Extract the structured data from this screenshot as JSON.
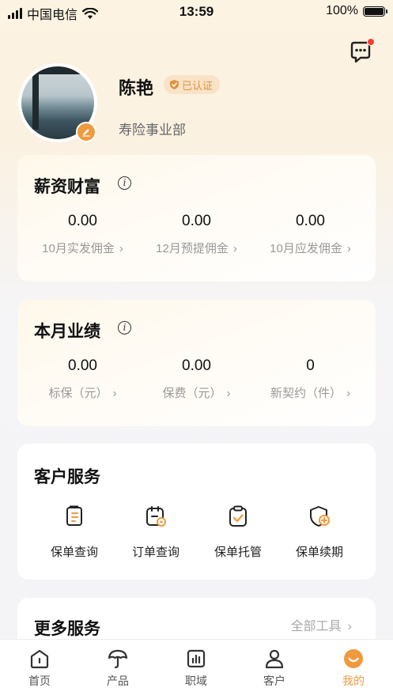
{
  "status_bar": {
    "carrier": "中国电信",
    "time": "13:59",
    "battery": "100%"
  },
  "profile": {
    "name": "陈艳",
    "verified": "已认证",
    "department": "寿险事业部"
  },
  "salary": {
    "title": "薪资财富",
    "items": [
      {
        "value": "0.00",
        "label": "10月实发佣金"
      },
      {
        "value": "0.00",
        "label": "12月预提佣金"
      },
      {
        "value": "0.00",
        "label": "10月应发佣金"
      }
    ]
  },
  "performance": {
    "title": "本月业绩",
    "items": [
      {
        "value": "0.00",
        "label": "标保（元）"
      },
      {
        "value": "0.00",
        "label": "保费（元）"
      },
      {
        "value": "0",
        "label": "新契约（件）"
      }
    ]
  },
  "customer_service": {
    "title": "客户服务",
    "items": [
      {
        "label": "保单查询",
        "icon": "policy-query-icon"
      },
      {
        "label": "订单查询",
        "icon": "order-query-icon"
      },
      {
        "label": "保单托管",
        "icon": "policy-custody-icon"
      },
      {
        "label": "保单续期",
        "icon": "policy-renewal-icon"
      }
    ]
  },
  "more_services": {
    "title": "更多服务",
    "link": "全部工具"
  },
  "tabbar": {
    "items": [
      {
        "label": "首页",
        "icon": "home-icon"
      },
      {
        "label": "产品",
        "icon": "umbrella-icon"
      },
      {
        "label": "职域",
        "icon": "chart-icon"
      },
      {
        "label": "客户",
        "icon": "person-icon"
      },
      {
        "label": "我的",
        "icon": "smile-icon"
      }
    ],
    "active": "我的"
  },
  "colors": {
    "accent": "#f09a3e",
    "badge_bg": "#f9e3c6",
    "notification": "#ff3b30"
  }
}
